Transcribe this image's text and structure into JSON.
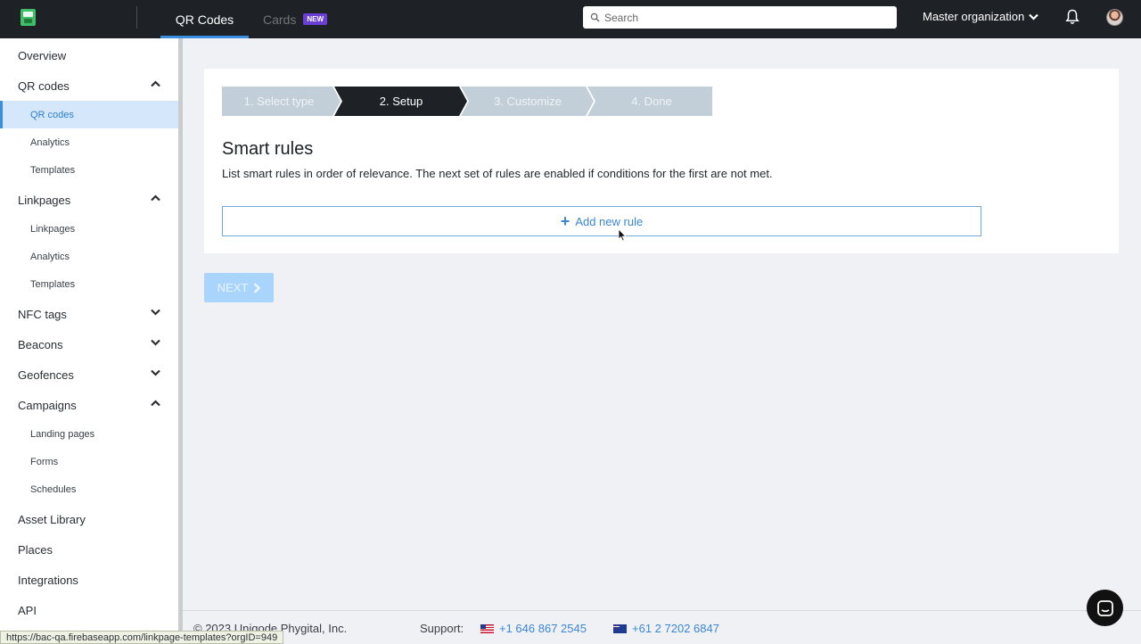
{
  "topbar": {
    "tabs": [
      {
        "label": "QR Codes",
        "active": true
      },
      {
        "label": "Cards",
        "badge": "NEW",
        "active": false
      }
    ],
    "search_placeholder": "Search",
    "org_label": "Master organization"
  },
  "sidebar": {
    "items": [
      {
        "label": "Overview"
      },
      {
        "label": "QR codes",
        "expanded": true
      },
      {
        "label": "QR codes",
        "sub": true,
        "active": true
      },
      {
        "label": "Analytics",
        "sub": true
      },
      {
        "label": "Templates",
        "sub": true
      },
      {
        "label": "Linkpages",
        "expanded": true
      },
      {
        "label": "Linkpages",
        "sub": true
      },
      {
        "label": "Analytics",
        "sub": true
      },
      {
        "label": "Templates",
        "sub": true
      },
      {
        "label": "NFC tags",
        "expanded": false
      },
      {
        "label": "Beacons",
        "expanded": false
      },
      {
        "label": "Geofences",
        "expanded": false
      },
      {
        "label": "Campaigns",
        "expanded": true
      },
      {
        "label": "Landing pages",
        "sub": true
      },
      {
        "label": "Forms",
        "sub": true
      },
      {
        "label": "Schedules",
        "sub": true
      },
      {
        "label": "Asset Library"
      },
      {
        "label": "Places"
      },
      {
        "label": "Integrations"
      },
      {
        "label": "API"
      }
    ]
  },
  "wizard": {
    "steps": [
      {
        "label": "1. Select type",
        "active": false
      },
      {
        "label": "2. Setup",
        "active": true
      },
      {
        "label": "3. Customize",
        "active": false
      },
      {
        "label": "4. Done",
        "active": false
      }
    ]
  },
  "main": {
    "title": "Smart rules",
    "description": "List smart rules in order of relevance. The next set of rules are enabled if conditions for the first are not met.",
    "add_rule_icon": "+",
    "add_rule_label": "Add new rule",
    "next_label": "NEXT"
  },
  "footer": {
    "copyright": "© 2023 Uniqode Phygital, Inc.",
    "support_label": "Support:",
    "phone_us": "+1 646 867 2545",
    "phone_au": "+61 2 7202 6847"
  },
  "status_url": "https://bac-qa.firebaseapp.com/linkpage-templates?orgID=949",
  "colors": {
    "accent": "#3b8fe0",
    "topbar": "#1e2227",
    "background": "#f0f1f5",
    "active_step": "#1e2227",
    "inactive_step": "#c2cfd9"
  }
}
